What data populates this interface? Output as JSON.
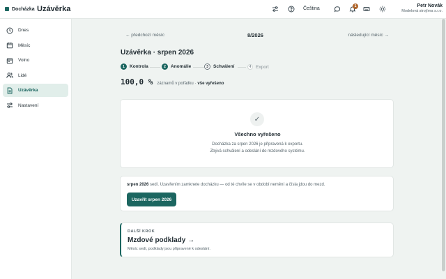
{
  "brand": {
    "name": "Docházka"
  },
  "header": {
    "title": "Uzávěrka",
    "language": "Čeština",
    "notifications_count": "1",
    "user_name": "Petr Novák",
    "user_org": "Modelová strojírna s.r.o."
  },
  "sidebar": {
    "items": [
      {
        "label": "Dnes",
        "icon": "clock-icon"
      },
      {
        "label": "Měsíc",
        "icon": "calendar-icon"
      },
      {
        "label": "Volno",
        "icon": "calendar-off-icon"
      },
      {
        "label": "Lidé",
        "icon": "users-icon"
      },
      {
        "label": "Uzávěrka",
        "icon": "document-icon",
        "active": true
      },
      {
        "label": "Nastavení",
        "icon": "sliders-icon"
      }
    ]
  },
  "monthnav": {
    "prev": "← předchozí měsíc",
    "current": "8/2026",
    "next": "následující měsíc →"
  },
  "page": {
    "heading": "Uzávěrka · srpen 2026"
  },
  "steps": [
    {
      "num": "1",
      "label": "Kontrola",
      "state": "done"
    },
    {
      "num": "2",
      "label": "Anomálie",
      "state": "done"
    },
    {
      "num": "3",
      "label": "Schválení",
      "state": "current"
    },
    {
      "num": "4",
      "label": "Export",
      "state": "todo"
    }
  ],
  "summary": {
    "percent": "100,0 %",
    "text": "záznamů v pořádku ·",
    "strong": "vše vyřešeno"
  },
  "ok_card": {
    "icon": "✓",
    "title": "Všechno vyřešeno",
    "line1": "Docházka za srpen 2026 je připravená k exportu.",
    "line2": "Zbývá schválení a odeslání do mzdového systému."
  },
  "close_card": {
    "month": "srpen 2026",
    "text": "sedí. Uzavřením zamknete docházku — od té chvíle se v období nemění a čísla jdou do mezd.",
    "button": "Uzavřít srpen 2026"
  },
  "next_card": {
    "eyebrow": "DALŠÍ KROK",
    "title": "Mzdové podklady →",
    "subtitle": "Měsíc sedí, podklady jsou připravené k odeslání."
  },
  "colors": {
    "accent": "#1c6660",
    "badge": "#b0662c",
    "background": "#eff3f1"
  }
}
